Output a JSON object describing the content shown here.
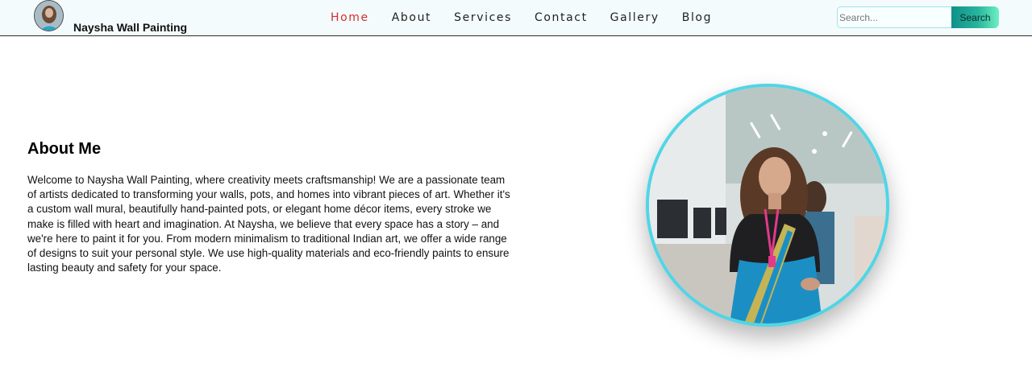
{
  "header": {
    "brand_name": "Naysha Wall Painting",
    "nav": [
      {
        "label": "Home",
        "active": true
      },
      {
        "label": "About",
        "active": false
      },
      {
        "label": "Services",
        "active": false
      },
      {
        "label": "Contact",
        "active": false
      },
      {
        "label": "Gallery",
        "active": false
      },
      {
        "label": "Blog",
        "active": false
      }
    ],
    "search": {
      "placeholder": "Search...",
      "value": "",
      "button_label": "Search"
    }
  },
  "about": {
    "title": "About Me",
    "text": "Welcome to Naysha Wall Painting, where creativity meets craftsmanship! We are a passionate team of artists dedicated to transforming your walls, pots, and homes into vibrant pieces of art. Whether it's a custom wall mural, beautifully hand-painted pots, or elegant home décor items, every stroke we make is filled with heart and imagination. At Naysha, we believe that every space has a story – and we're here to paint it for you. From modern minimalism to traditional Indian art, we offer a wide range of designs to suit your personal style. We use high-quality materials and eco-friendly paints to ensure lasting beauty and safety for your space."
  },
  "colors": {
    "nav_active": "#d62d2d",
    "accent_border": "#4fd6e6",
    "search_button_start": "#119089",
    "search_button_end": "#6ef0c1"
  },
  "icons": {
    "logo": "profile-photo-avatar",
    "portrait": "profile-portrait-photo"
  }
}
